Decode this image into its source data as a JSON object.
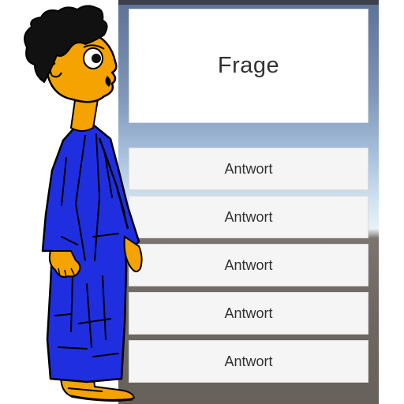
{
  "quiz": {
    "question": "Frage",
    "answers": [
      {
        "label": "Antwort"
      },
      {
        "label": "Antwort"
      },
      {
        "label": "Antwort"
      },
      {
        "label": "Antwort"
      },
      {
        "label": "Antwort"
      }
    ]
  },
  "character": {
    "icon": "robed-character-icon",
    "robe_color": "#1f2fe0",
    "skin_color": "#f5a300",
    "hair_color": "#111111"
  }
}
